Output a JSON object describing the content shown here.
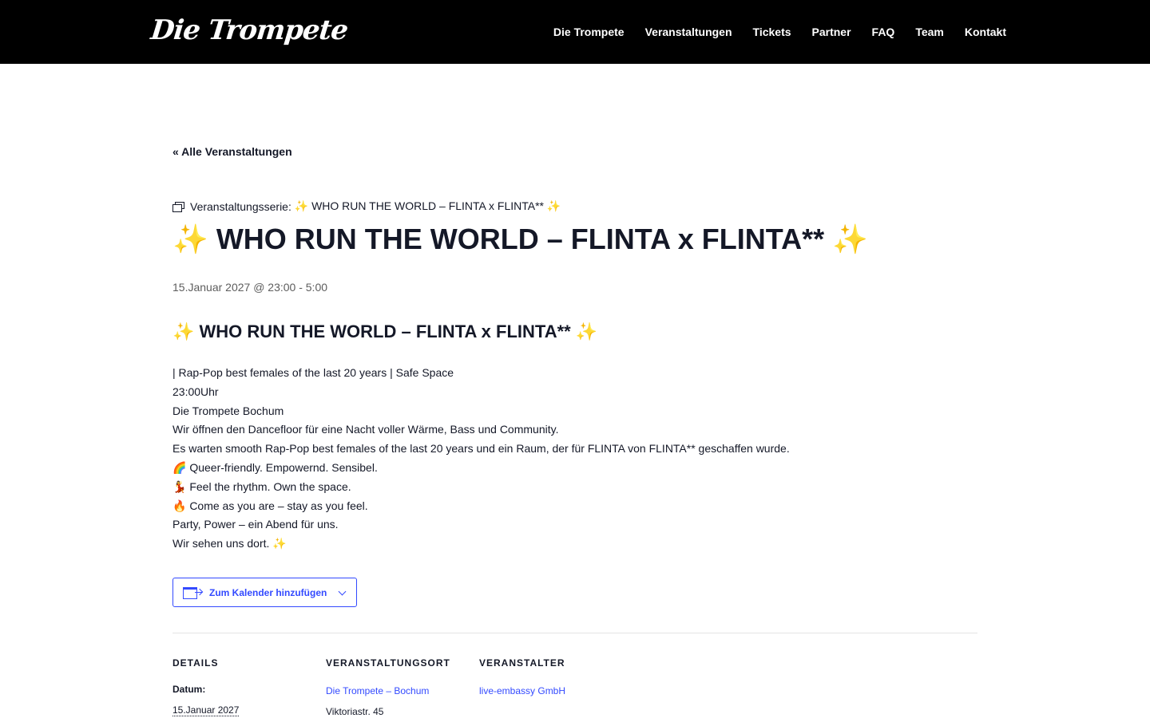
{
  "header": {
    "logo_text": "Die Trompete",
    "nav": [
      "Die Trompete",
      "Veranstaltungen",
      "Tickets",
      "Partner",
      "FAQ",
      "Team",
      "Kontakt"
    ]
  },
  "back_link": "« Alle Veranstaltungen",
  "series": {
    "prefix": "Veranstaltungsserie:",
    "name": "✨ WHO RUN THE WORLD – FLINTA x FLINTA** ✨"
  },
  "event": {
    "title": "✨ WHO RUN THE WORLD – FLINTA x FLINTA** ✨",
    "datetime": "15.Januar 2027 @ 23:00 - 5:00"
  },
  "content": {
    "heading": "✨ WHO RUN THE WORLD – FLINTA x FLINTA** ✨",
    "lines": [
      "| Rap-Pop best females of the last 20 years | Safe Space",
      "23:00Uhr",
      "Die Trompete Bochum",
      "Wir öffnen den Dancefloor für eine Nacht voller Wärme, Bass und Community.",
      "Es warten smooth Rap-Pop best females of the last 20 years und ein Raum, der für FLINTA von FLINTA** geschaffen wurde.",
      "🌈 Queer-friendly. Empowernd. Sensibel.",
      "💃 Feel the rhythm. Own the space.",
      "🔥 Come as you are – stay as you feel.",
      "Party, Power – ein Abend für uns.",
      "Wir sehen uns dort. ✨"
    ]
  },
  "calendar_button": "Zum Kalender hinzufügen",
  "meta": {
    "details_heading": "DETAILS",
    "date_label": "Datum:",
    "date_value": "15.Januar 2027",
    "venue_heading": "VERANSTALTUNGSORT",
    "venue_name": "Die Trompete – Bochum",
    "venue_street": "Viktoriastr. 45",
    "organizer_heading": "VERANSTALTER",
    "organizer_name": "live-embassy GmbH"
  },
  "colors": {
    "header_bg": "#000000",
    "text": "#141827",
    "accent": "#334aff",
    "muted": "#5d5d5d"
  }
}
